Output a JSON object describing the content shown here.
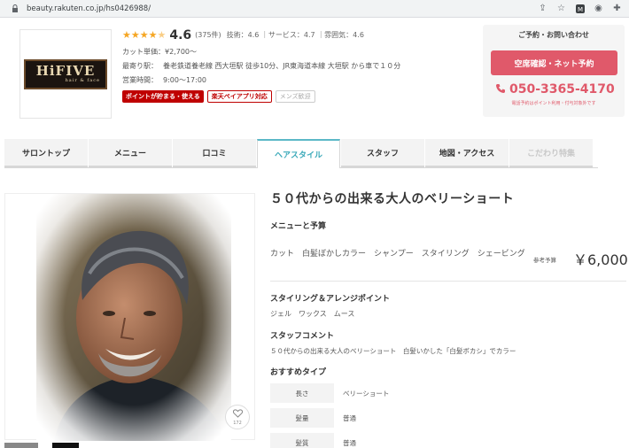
{
  "browser": {
    "url": "beauty.rakuten.co.jp/hs0426988/"
  },
  "salon": {
    "logo_text": "HiFIVE",
    "logo_sub": "hair & face",
    "rating": "4.6",
    "review_count": "(375件)",
    "scores": "技術：4.6 ｜サービス：4.7 ｜雰囲気：4.6",
    "cut_price_label": "カット単価：",
    "cut_price": "¥2,700〜",
    "station_label": "最寄り駅：",
    "station": "養老鉄道養老線 西大垣駅 徒歩10分、JR東海道本線 大垣駅 から車で１０分",
    "hours_label": "営業時間：",
    "hours": "9:00〜17:00",
    "badges": [
      "ポイントが貯まる・使える",
      "楽天ペイアプリ対応",
      "メンズ歓迎"
    ]
  },
  "reserve": {
    "title": "ご予約・お問い合わせ",
    "button": "空席確認・ネット予約",
    "tel": "050-3365-4170",
    "note": "電話予約はポイント利用・付与対象外です"
  },
  "tabs": [
    {
      "label": "サロントップ"
    },
    {
      "label": "メニュー"
    },
    {
      "label": "口コミ"
    },
    {
      "label": "ヘアスタイル"
    },
    {
      "label": "スタッフ"
    },
    {
      "label": "地図・アクセス"
    },
    {
      "label": "こだわり特集"
    }
  ],
  "style": {
    "title": "５０代からの出来る大人のベリーショート",
    "like_count": "172",
    "menu_heading": "メニューと予算",
    "menu_items": "カット　白髪ぼかしカラー　シャンプー　スタイリング　シェービング",
    "price_label": "参考予算",
    "price": "￥6,000",
    "arrange_heading": "スタイリング＆アレンジポイント",
    "arrange_items": "ジェル　ワックス　ムース",
    "comment_heading": "スタッフコメント",
    "comment": "５０代からの出来る大人のベリーショート　白髪いかした「白髪ボカシ」でカラー",
    "type_heading": "おすすめタイプ",
    "types": [
      {
        "label": "長さ",
        "value": "ベリーショート"
      },
      {
        "label": "髪量",
        "value": "普通"
      },
      {
        "label": "髪質",
        "value": "普通"
      }
    ]
  },
  "colors": {
    "accent_pink": "#e0596a",
    "rakuten_red": "#bf0000",
    "tab_active": "#3aa9b9",
    "star": "#f5a623"
  }
}
